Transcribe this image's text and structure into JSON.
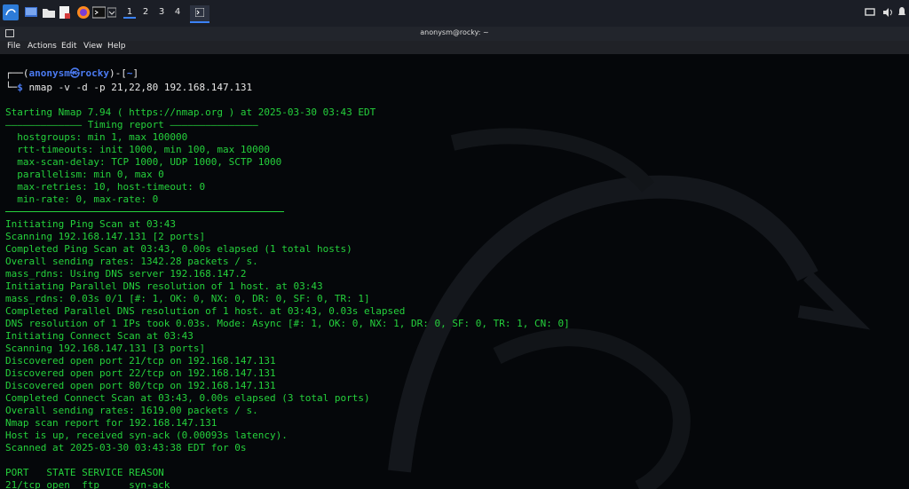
{
  "taskbar": {
    "workspaces": [
      "1",
      "2",
      "3",
      "4"
    ],
    "icons": [
      "kali-menu-icon",
      "show-desktop-icon",
      "file-manager-icon",
      "text-editor-icon",
      "firefox-icon",
      "terminal-launcher-icon",
      "chevron-down-icon",
      "terminal-task-icon",
      "screen-icon",
      "volume-icon",
      "notification-icon"
    ]
  },
  "window": {
    "title": "anonysm@rocky: ~"
  },
  "menu": {
    "file": "File",
    "actions": "Actions",
    "edit": "Edit",
    "view": "View",
    "help": "Help"
  },
  "prompt": {
    "open": "┌──(",
    "user": "anonysm",
    "at": "㉿",
    "host": "rocky",
    "mid": ")-[",
    "dir": "~",
    "close": "]",
    "arrow": "└─",
    "dollar": "$",
    "command": " nmap -v -d -p 21,22,80 192.168.147.131"
  },
  "timing": {
    "dash_left": "—————————————",
    "title": " Timing report ",
    "dash_right": "———————————————"
  },
  "output": [
    "Starting Nmap 7.94 ( https://nmap.org ) at 2025-03-30 03:43 EDT",
    "  hostgroups: min 1, max 100000",
    "  rtt-timeouts: init 1000, min 100, max 10000",
    "  max-scan-delay: TCP 1000, UDP 1000, SCTP 1000",
    "  parallelism: min 0, max 0",
    "  max-retries: 10, host-timeout: 0",
    "  min-rate: 0, max-rate: 0",
    "Initiating Ping Scan at 03:43",
    "Scanning 192.168.147.131 [2 ports]",
    "Completed Ping Scan at 03:43, 0.00s elapsed (1 total hosts)",
    "Overall sending rates: 1342.28 packets / s.",
    "mass_rdns: Using DNS server 192.168.147.2",
    "Initiating Parallel DNS resolution of 1 host. at 03:43",
    "mass_rdns: 0.03s 0/1 [#: 1, OK: 0, NX: 0, DR: 0, SF: 0, TR: 1]",
    "Completed Parallel DNS resolution of 1 host. at 03:43, 0.03s elapsed",
    "DNS resolution of 1 IPs took 0.03s. Mode: Async [#: 1, OK: 0, NX: 1, DR: 0, SF: 0, TR: 1, CN: 0]",
    "Initiating Connect Scan at 03:43",
    "Scanning 192.168.147.131 [3 ports]",
    "Discovered open port 21/tcp on 192.168.147.131",
    "Discovered open port 22/tcp on 192.168.147.131",
    "Discovered open port 80/tcp on 192.168.147.131",
    "Completed Connect Scan at 03:43, 0.00s elapsed (3 total ports)",
    "Overall sending rates: 1619.00 packets / s.",
    "Nmap scan report for 192.168.147.131",
    "Host is up, received syn-ack (0.00093s latency).",
    "Scanned at 2025-03-30 03:43:38 EDT for 0s",
    "PORT   STATE SERVICE REASON",
    "21/tcp open  ftp     syn-ack"
  ],
  "colors": {
    "text": "#25d13c",
    "prompt": "#4b7bf2",
    "background": "#05070a",
    "bar": "#1b1e26"
  }
}
